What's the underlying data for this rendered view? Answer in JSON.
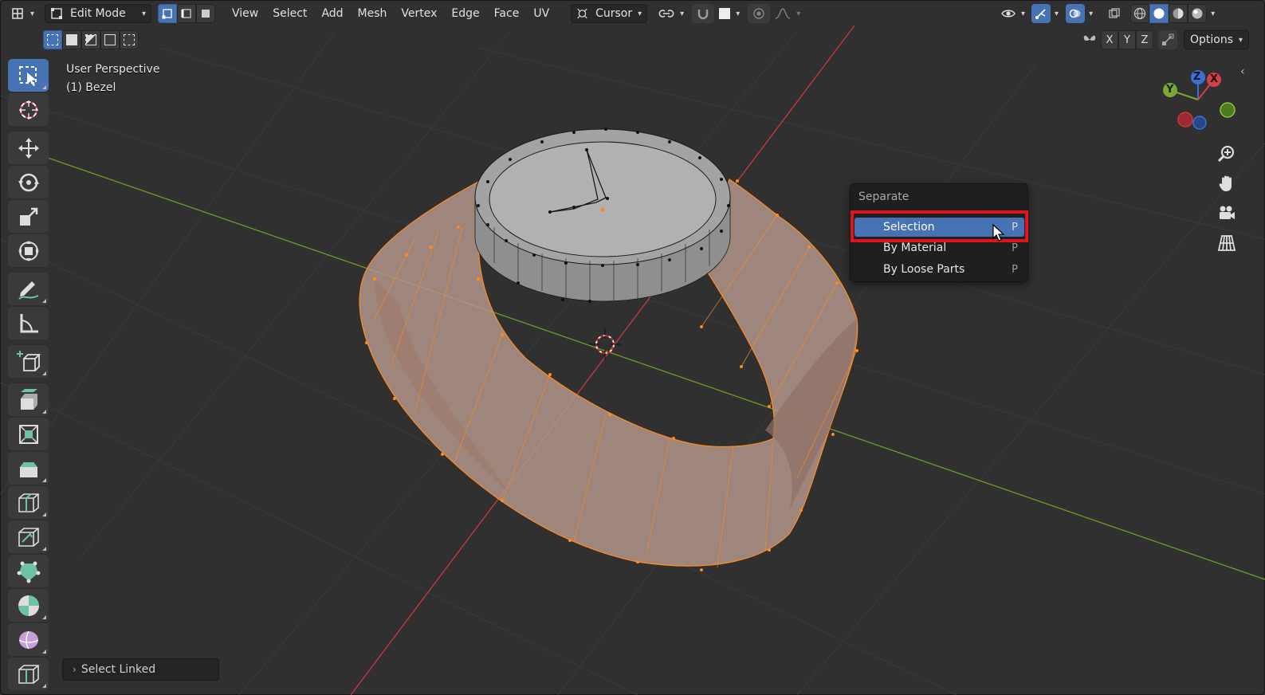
{
  "header": {
    "mode_label": "Edit Mode",
    "menus": [
      "View",
      "Select",
      "Add",
      "Mesh",
      "Vertex",
      "Edge",
      "Face",
      "UV"
    ],
    "pivot_label": "Cursor",
    "options_label": "Options",
    "axes": [
      "X",
      "Y",
      "Z"
    ]
  },
  "viewport": {
    "view_name": "User Perspective",
    "object_name": "(1) Bezel"
  },
  "gizmo": {
    "z": "Z",
    "y": "Y",
    "x": "X"
  },
  "context_menu": {
    "title": "Separate",
    "items": [
      {
        "label": "Selection",
        "shortcut": "P"
      },
      {
        "label": "By Material",
        "shortcut": "P"
      },
      {
        "label": "By Loose Parts",
        "shortcut": "P"
      }
    ]
  },
  "last_operator": {
    "label": "Select Linked"
  },
  "colors": {
    "background": "#303030",
    "accent_blue": "#4772b3",
    "selection_orange": "#ff8a1e",
    "highlight_red": "#e0141c",
    "axis_x": "#c9383f",
    "axis_y": "#6a9b2a"
  }
}
